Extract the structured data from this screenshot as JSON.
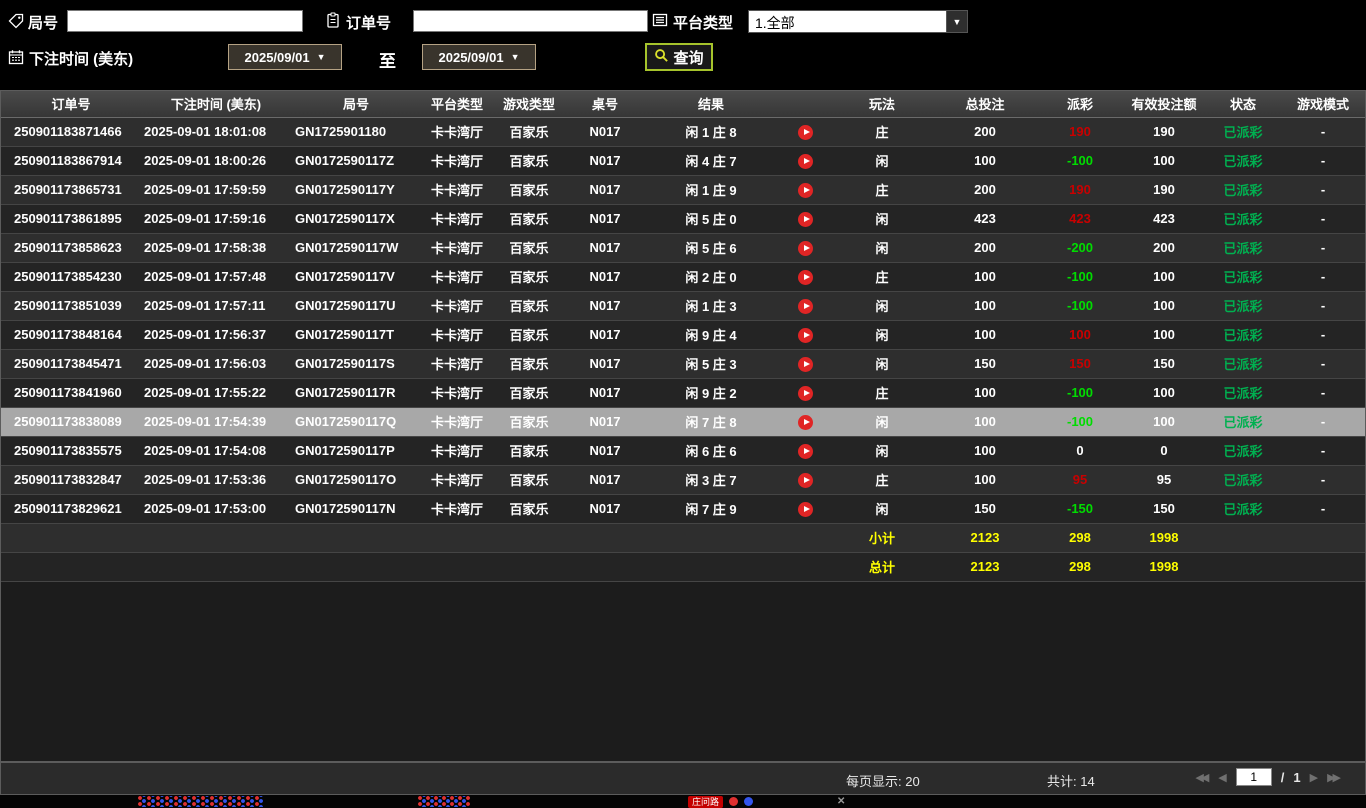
{
  "icons": {
    "caret": "▼",
    "first": "◀◀",
    "prev": "◀",
    "next": "▶",
    "last": "▶▶",
    "close": "✕"
  },
  "colors": {
    "win": "#c80000",
    "loss": "#00dd00",
    "status_paid": "#00b050",
    "summary": "#ffff00",
    "query_border": "#a6c42c"
  },
  "filters": {
    "round_label": "局号",
    "round_value": "",
    "order_label": "订单号",
    "order_value": "",
    "platform_label": "平台类型",
    "platform_value": "1.全部",
    "bet_time_label": "下注时间 (美东)",
    "date_from": "2025/09/01",
    "to_label": "至",
    "date_to": "2025/09/01",
    "search_label": "查询"
  },
  "table": {
    "headers": [
      "订单号",
      "下注时间 (美东)",
      "局号",
      "平台类型",
      "游戏类型",
      "桌号",
      "结果",
      "",
      "玩法",
      "总投注",
      "派彩",
      "有效投注额",
      "状态",
      "游戏模式"
    ],
    "rows": [
      {
        "order": "250901183871466",
        "time": "2025-09-01 18:01:08",
        "round": "GN1725901180",
        "platform": "卡卡湾厅",
        "game": "百家乐",
        "table": "N017",
        "result": "闲 1 庄 8",
        "play": "庄",
        "total": "200",
        "payout": "190",
        "payout_class": "win",
        "valid": "190",
        "status": "已派彩",
        "mode": "-"
      },
      {
        "order": "250901183867914",
        "time": "2025-09-01 18:00:26",
        "round": "GN0172590117Z",
        "platform": "卡卡湾厅",
        "game": "百家乐",
        "table": "N017",
        "result": "闲 4 庄 7",
        "play": "闲",
        "total": "100",
        "payout": "-100",
        "payout_class": "loss",
        "valid": "100",
        "status": "已派彩",
        "mode": "-"
      },
      {
        "order": "250901173865731",
        "time": "2025-09-01 17:59:59",
        "round": "GN0172590117Y",
        "platform": "卡卡湾厅",
        "game": "百家乐",
        "table": "N017",
        "result": "闲 1 庄 9",
        "play": "庄",
        "total": "200",
        "payout": "190",
        "payout_class": "win",
        "valid": "190",
        "status": "已派彩",
        "mode": "-"
      },
      {
        "order": "250901173861895",
        "time": "2025-09-01 17:59:16",
        "round": "GN0172590117X",
        "platform": "卡卡湾厅",
        "game": "百家乐",
        "table": "N017",
        "result": "闲 5 庄 0",
        "play": "闲",
        "total": "423",
        "payout": "423",
        "payout_class": "win",
        "valid": "423",
        "status": "已派彩",
        "mode": "-"
      },
      {
        "order": "250901173858623",
        "time": "2025-09-01 17:58:38",
        "round": "GN0172590117W",
        "platform": "卡卡湾厅",
        "game": "百家乐",
        "table": "N017",
        "result": "闲 5 庄 6",
        "play": "闲",
        "total": "200",
        "payout": "-200",
        "payout_class": "loss",
        "valid": "200",
        "status": "已派彩",
        "mode": "-"
      },
      {
        "order": "250901173854230",
        "time": "2025-09-01 17:57:48",
        "round": "GN0172590117V",
        "platform": "卡卡湾厅",
        "game": "百家乐",
        "table": "N017",
        "result": "闲 2 庄 0",
        "play": "庄",
        "total": "100",
        "payout": "-100",
        "payout_class": "loss",
        "valid": "100",
        "status": "已派彩",
        "mode": "-"
      },
      {
        "order": "250901173851039",
        "time": "2025-09-01 17:57:11",
        "round": "GN0172590117U",
        "platform": "卡卡湾厅",
        "game": "百家乐",
        "table": "N017",
        "result": "闲 1 庄 3",
        "play": "闲",
        "total": "100",
        "payout": "-100",
        "payout_class": "loss",
        "valid": "100",
        "status": "已派彩",
        "mode": "-"
      },
      {
        "order": "250901173848164",
        "time": "2025-09-01 17:56:37",
        "round": "GN0172590117T",
        "platform": "卡卡湾厅",
        "game": "百家乐",
        "table": "N017",
        "result": "闲 9 庄 4",
        "play": "闲",
        "total": "100",
        "payout": "100",
        "payout_class": "win",
        "valid": "100",
        "status": "已派彩",
        "mode": "-"
      },
      {
        "order": "250901173845471",
        "time": "2025-09-01 17:56:03",
        "round": "GN0172590117S",
        "platform": "卡卡湾厅",
        "game": "百家乐",
        "table": "N017",
        "result": "闲 5 庄 3",
        "play": "闲",
        "total": "150",
        "payout": "150",
        "payout_class": "win",
        "valid": "150",
        "status": "已派彩",
        "mode": "-"
      },
      {
        "order": "250901173841960",
        "time": "2025-09-01 17:55:22",
        "round": "GN0172590117R",
        "platform": "卡卡湾厅",
        "game": "百家乐",
        "table": "N017",
        "result": "闲 9 庄 2",
        "play": "庄",
        "total": "100",
        "payout": "-100",
        "payout_class": "loss",
        "valid": "100",
        "status": "已派彩",
        "mode": "-"
      },
      {
        "order": "250901173838089",
        "time": "2025-09-01 17:54:39",
        "round": "GN0172590117Q",
        "platform": "卡卡湾厅",
        "game": "百家乐",
        "table": "N017",
        "result": "闲 7 庄 8",
        "play": "闲",
        "total": "100",
        "payout": "-100",
        "payout_class": "loss",
        "valid": "100",
        "status": "已派彩",
        "mode": "-",
        "selected": true
      },
      {
        "order": "250901173835575",
        "time": "2025-09-01 17:54:08",
        "round": "GN0172590117P",
        "platform": "卡卡湾厅",
        "game": "百家乐",
        "table": "N017",
        "result": "闲 6 庄 6",
        "play": "闲",
        "total": "100",
        "payout": "0",
        "payout_class": "zero",
        "valid": "0",
        "status": "已派彩",
        "mode": "-"
      },
      {
        "order": "250901173832847",
        "time": "2025-09-01 17:53:36",
        "round": "GN0172590117O",
        "platform": "卡卡湾厅",
        "game": "百家乐",
        "table": "N017",
        "result": "闲 3 庄 7",
        "play": "庄",
        "total": "100",
        "payout": "95",
        "payout_class": "win",
        "valid": "95",
        "status": "已派彩",
        "mode": "-"
      },
      {
        "order": "250901173829621",
        "time": "2025-09-01 17:53:00",
        "round": "GN0172590117N",
        "platform": "卡卡湾厅",
        "game": "百家乐",
        "table": "N017",
        "result": "闲 7 庄 9",
        "play": "闲",
        "total": "150",
        "payout": "-150",
        "payout_class": "loss",
        "valid": "150",
        "status": "已派彩",
        "mode": "-"
      }
    ],
    "subtotal": {
      "label": "小计",
      "total": "2123",
      "payout": "298",
      "valid": "1998"
    },
    "grand_total": {
      "label": "总计",
      "total": "2123",
      "payout": "298",
      "valid": "1998"
    }
  },
  "footer": {
    "per_page": "每页显示: 20",
    "total_count": "共计: 14",
    "page_current": "1",
    "page_separator": "/",
    "page_total": "1"
  },
  "background": {
    "fragment_label": "庄问路"
  }
}
